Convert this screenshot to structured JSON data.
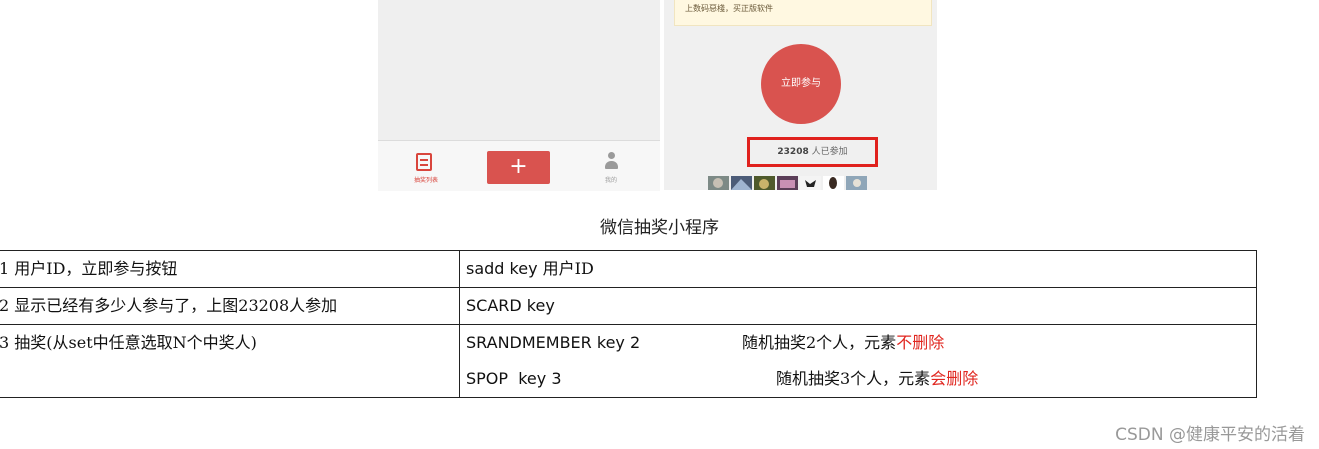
{
  "screenshot": {
    "left_phone": {
      "tab_list_label": "抽奖列表",
      "plus_symbol": "+",
      "tab_me_label": "我的"
    },
    "right_phone": {
      "notice_text": "上数码惡棧，买正版软件",
      "join_button_label": "立即参与",
      "participant_count": "23208",
      "participant_suffix": " 人已参加"
    },
    "colors": {
      "accent": "#d9534f",
      "highlight_box": "#e0211d"
    }
  },
  "caption": "微信抽奖小程序",
  "table": {
    "rows": [
      {
        "left": "1 用户ID，立即参与按钮",
        "cmd": "sadd key ",
        "cmd_tail": "用户ID"
      },
      {
        "left": "2 显示已经有多少人参与了，上图23208人参加",
        "cmd": "SCARD key"
      },
      {
        "left": "3 抽奖(从set中任意选取N个中奖人)",
        "lines": [
          {
            "cmd": "SRANDMEMBER key 2",
            "note": "随机抽奖2个人，元素",
            "note_red": "不删除"
          },
          {
            "cmd": "SPOP  key 3",
            "note": "随机抽奖3个人，元素",
            "note_red": "会删除"
          }
        ]
      }
    ]
  },
  "watermark": "CSDN @健康平安的活着"
}
